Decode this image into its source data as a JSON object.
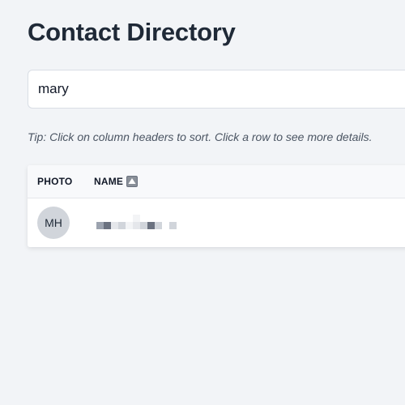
{
  "page": {
    "title": "Contact Directory",
    "tip": "Tip: Click on column headers to sort. Click a row to see more details."
  },
  "search": {
    "value": "mary",
    "placeholder": ""
  },
  "table": {
    "columns": [
      {
        "label": "PHOTO"
      },
      {
        "label": "NAME",
        "sort": "ascending",
        "sort_icon": "triangle-up-icon"
      }
    ],
    "rows": [
      {
        "initials": "MH",
        "name_redacted": true
      }
    ]
  },
  "colors": {
    "background": "#f2f4f7",
    "title": "#1f2937",
    "avatar_bg": "#d1d5db",
    "header_bg": "#f8f9fb"
  }
}
